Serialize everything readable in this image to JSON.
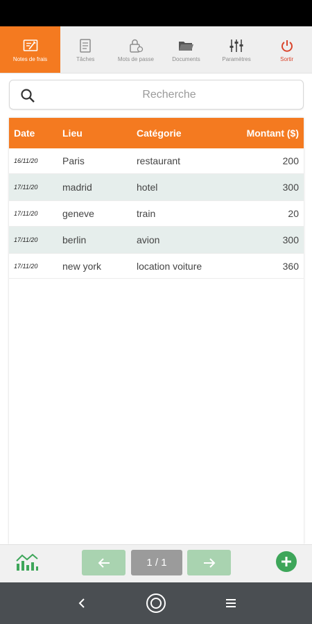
{
  "nav": {
    "items": [
      {
        "label": "Notes de frais",
        "icon": "receipt-icon"
      },
      {
        "label": "Tâches",
        "icon": "tasks-icon"
      },
      {
        "label": "Mots de passe",
        "icon": "lock-icon"
      },
      {
        "label": "Documents",
        "icon": "folder-icon"
      },
      {
        "label": "Paramètres",
        "icon": "sliders-icon"
      },
      {
        "label": "Sortir",
        "icon": "power-icon"
      }
    ],
    "active_index": 0
  },
  "search": {
    "placeholder": "Recherche",
    "value": ""
  },
  "table": {
    "columns": [
      "Date",
      "Lieu",
      "Catégorie",
      "Montant ($)"
    ],
    "rows": [
      {
        "date": "16/11/20",
        "lieu": "Paris",
        "categorie": "restaurant",
        "montant": "200"
      },
      {
        "date": "17/11/20",
        "lieu": "madrid",
        "categorie": "hotel",
        "montant": "300"
      },
      {
        "date": "17/11/20",
        "lieu": "geneve",
        "categorie": "train",
        "montant": "20"
      },
      {
        "date": "17/11/20",
        "lieu": "berlin",
        "categorie": "avion",
        "montant": "300"
      },
      {
        "date": "17/11/20",
        "lieu": "new york",
        "categorie": "location voiture",
        "montant": "360"
      }
    ]
  },
  "pagination": {
    "label": "1 / 1"
  },
  "colors": {
    "accent": "#f47a20",
    "stripe": "#e6eeec",
    "green": "#3ea65a",
    "button_green": "#a9d3b0"
  }
}
